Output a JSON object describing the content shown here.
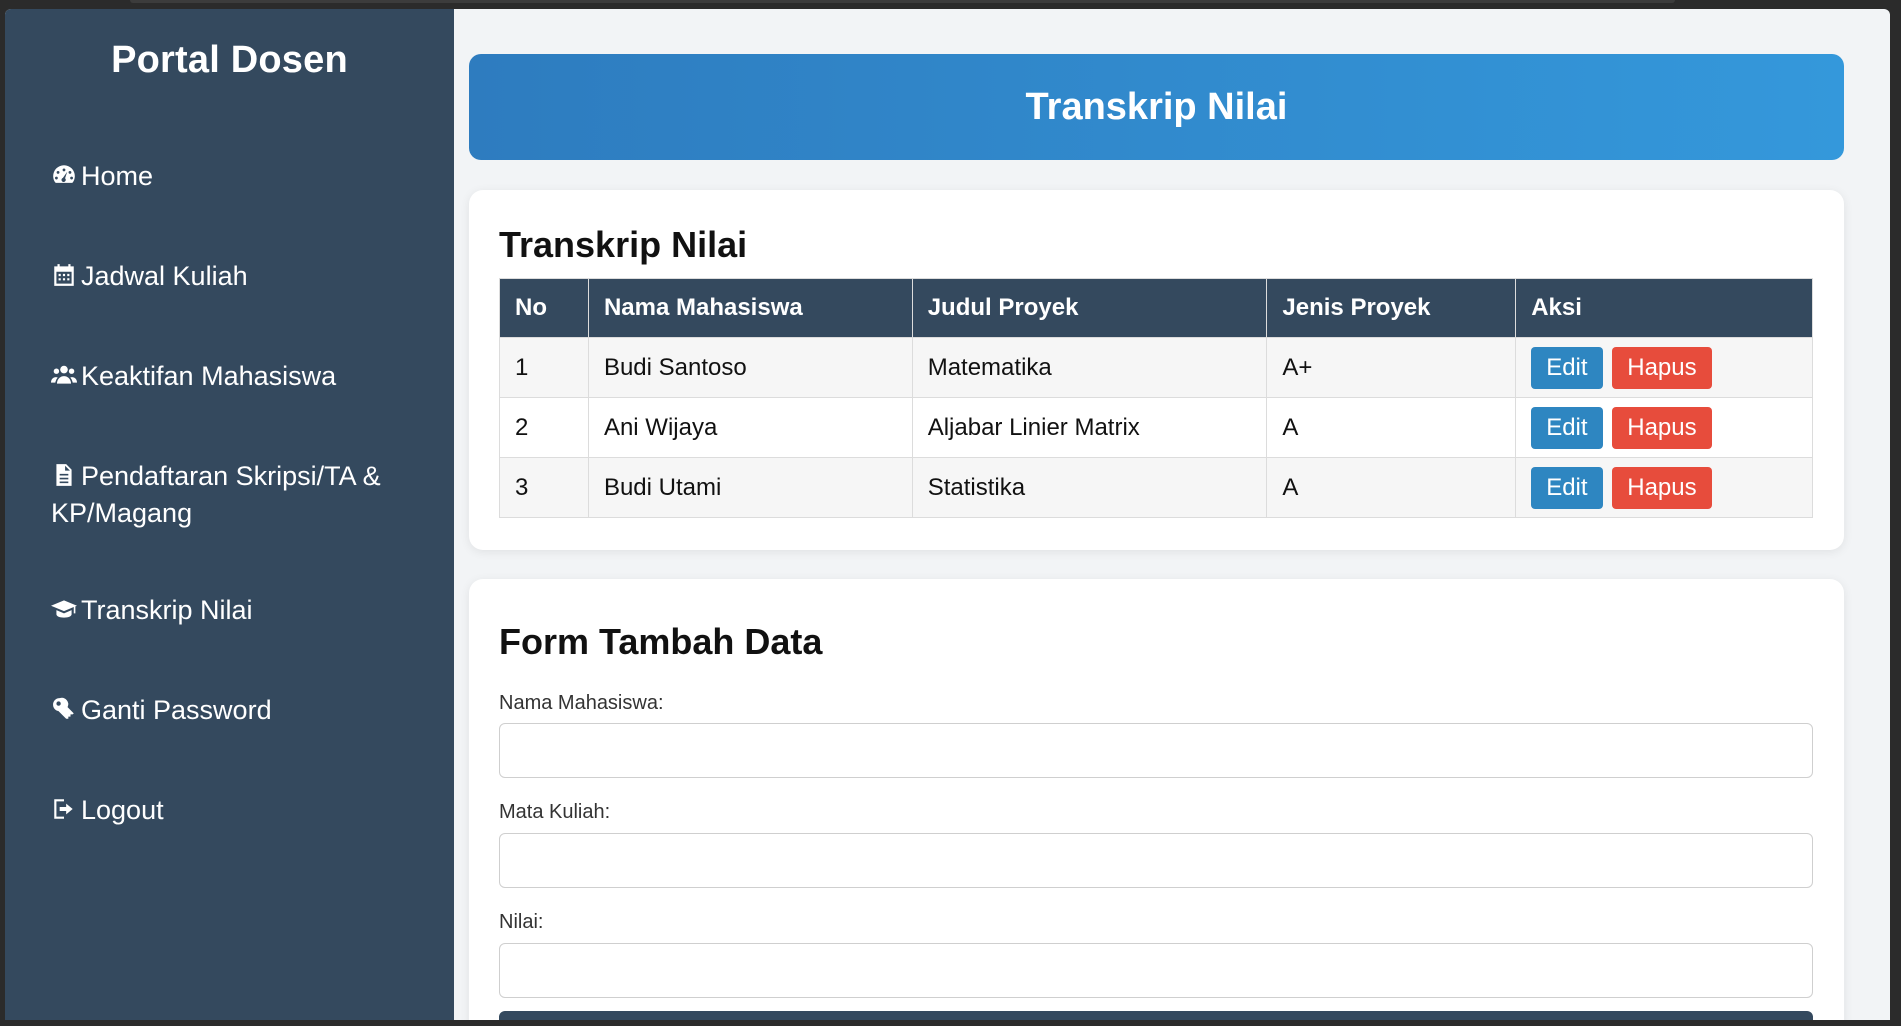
{
  "sidebar": {
    "brand": "Portal Dosen",
    "items": [
      {
        "label": "Home",
        "icon": "dashboard-icon"
      },
      {
        "label": "Jadwal Kuliah",
        "icon": "calendar-icon"
      },
      {
        "label": "Keaktifan Mahasiswa",
        "icon": "users-icon"
      },
      {
        "label": "Pendaftaran Skripsi/TA & KP/Magang",
        "icon": "document-icon"
      },
      {
        "label": "Transkrip Nilai",
        "icon": "graduation-cap-icon"
      },
      {
        "label": "Ganti Password",
        "icon": "key-icon"
      },
      {
        "label": "Logout",
        "icon": "logout-icon"
      }
    ]
  },
  "header": {
    "title": "Transkrip Nilai"
  },
  "table_section": {
    "title": "Transkrip Nilai",
    "columns": [
      "No",
      "Nama Mahasiswa",
      "Judul Proyek",
      "Jenis Proyek",
      "Aksi"
    ],
    "rows": [
      {
        "no": "1",
        "nama": "Budi Santoso",
        "judul": "Matematika",
        "jenis": "A+"
      },
      {
        "no": "2",
        "nama": "Ani Wijaya",
        "judul": "Aljabar Linier Matrix",
        "jenis": "A"
      },
      {
        "no": "3",
        "nama": "Budi Utami",
        "judul": "Statistika",
        "jenis": "A"
      }
    ],
    "edit_label": "Edit",
    "delete_label": "Hapus"
  },
  "form": {
    "title": "Form Tambah Data",
    "fields": [
      {
        "label": "Nama Mahasiswa:",
        "value": ""
      },
      {
        "label": "Mata Kuliah:",
        "value": ""
      },
      {
        "label": "Nilai:",
        "value": ""
      }
    ]
  },
  "colors": {
    "sidebar": "#34495e",
    "accent": "#3498db",
    "edit": "#2e86c1",
    "delete": "#e74c3c"
  }
}
